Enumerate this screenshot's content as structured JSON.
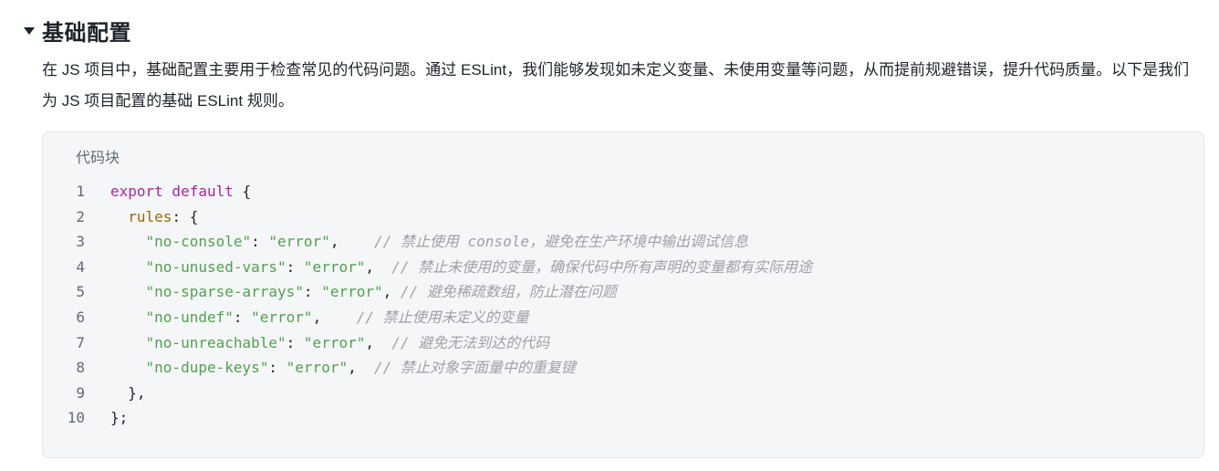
{
  "section": {
    "title": "基础配置"
  },
  "paragraph": {
    "text": "在 JS 项目中，基础配置主要用于检查常见的代码问题。通过 ESLint，我们能够发现如未定义变量、未使用变量等问题，从而提前规避错误，提升代码质量。以下是我们为 JS 项目配置的基础 ESLint 规则。"
  },
  "code_block": {
    "label": "代码块",
    "lines": [
      {
        "num": "1",
        "kw": "export default",
        "rest": " {"
      },
      {
        "num": "2",
        "indent": "  ",
        "prop": "rules",
        "rest": ": {"
      },
      {
        "num": "3",
        "indent": "    ",
        "key": "\"no-console\"",
        "sep": ": ",
        "val": "\"error\"",
        "after": ",    ",
        "comment": "// 禁止使用 console，避免在生产环境中输出调试信息"
      },
      {
        "num": "4",
        "indent": "    ",
        "key": "\"no-unused-vars\"",
        "sep": ": ",
        "val": "\"error\"",
        "after": ",  ",
        "comment": "// 禁止未使用的变量，确保代码中所有声明的变量都有实际用途"
      },
      {
        "num": "5",
        "indent": "    ",
        "key": "\"no-sparse-arrays\"",
        "sep": ": ",
        "val": "\"error\"",
        "after": ", ",
        "comment": "// 避免稀疏数组，防止潜在问题"
      },
      {
        "num": "6",
        "indent": "    ",
        "key": "\"no-undef\"",
        "sep": ": ",
        "val": "\"error\"",
        "after": ",    ",
        "comment": "// 禁止使用未定义的变量"
      },
      {
        "num": "7",
        "indent": "    ",
        "key": "\"no-unreachable\"",
        "sep": ": ",
        "val": "\"error\"",
        "after": ",  ",
        "comment": "// 避免无法到达的代码"
      },
      {
        "num": "8",
        "indent": "    ",
        "key": "\"no-dupe-keys\"",
        "sep": ": ",
        "val": "\"error\"",
        "after": ",  ",
        "comment": "// 禁止对象字面量中的重复键"
      },
      {
        "num": "9",
        "indent": "  ",
        "rest": "},"
      },
      {
        "num": "10",
        "rest": "};"
      }
    ]
  }
}
